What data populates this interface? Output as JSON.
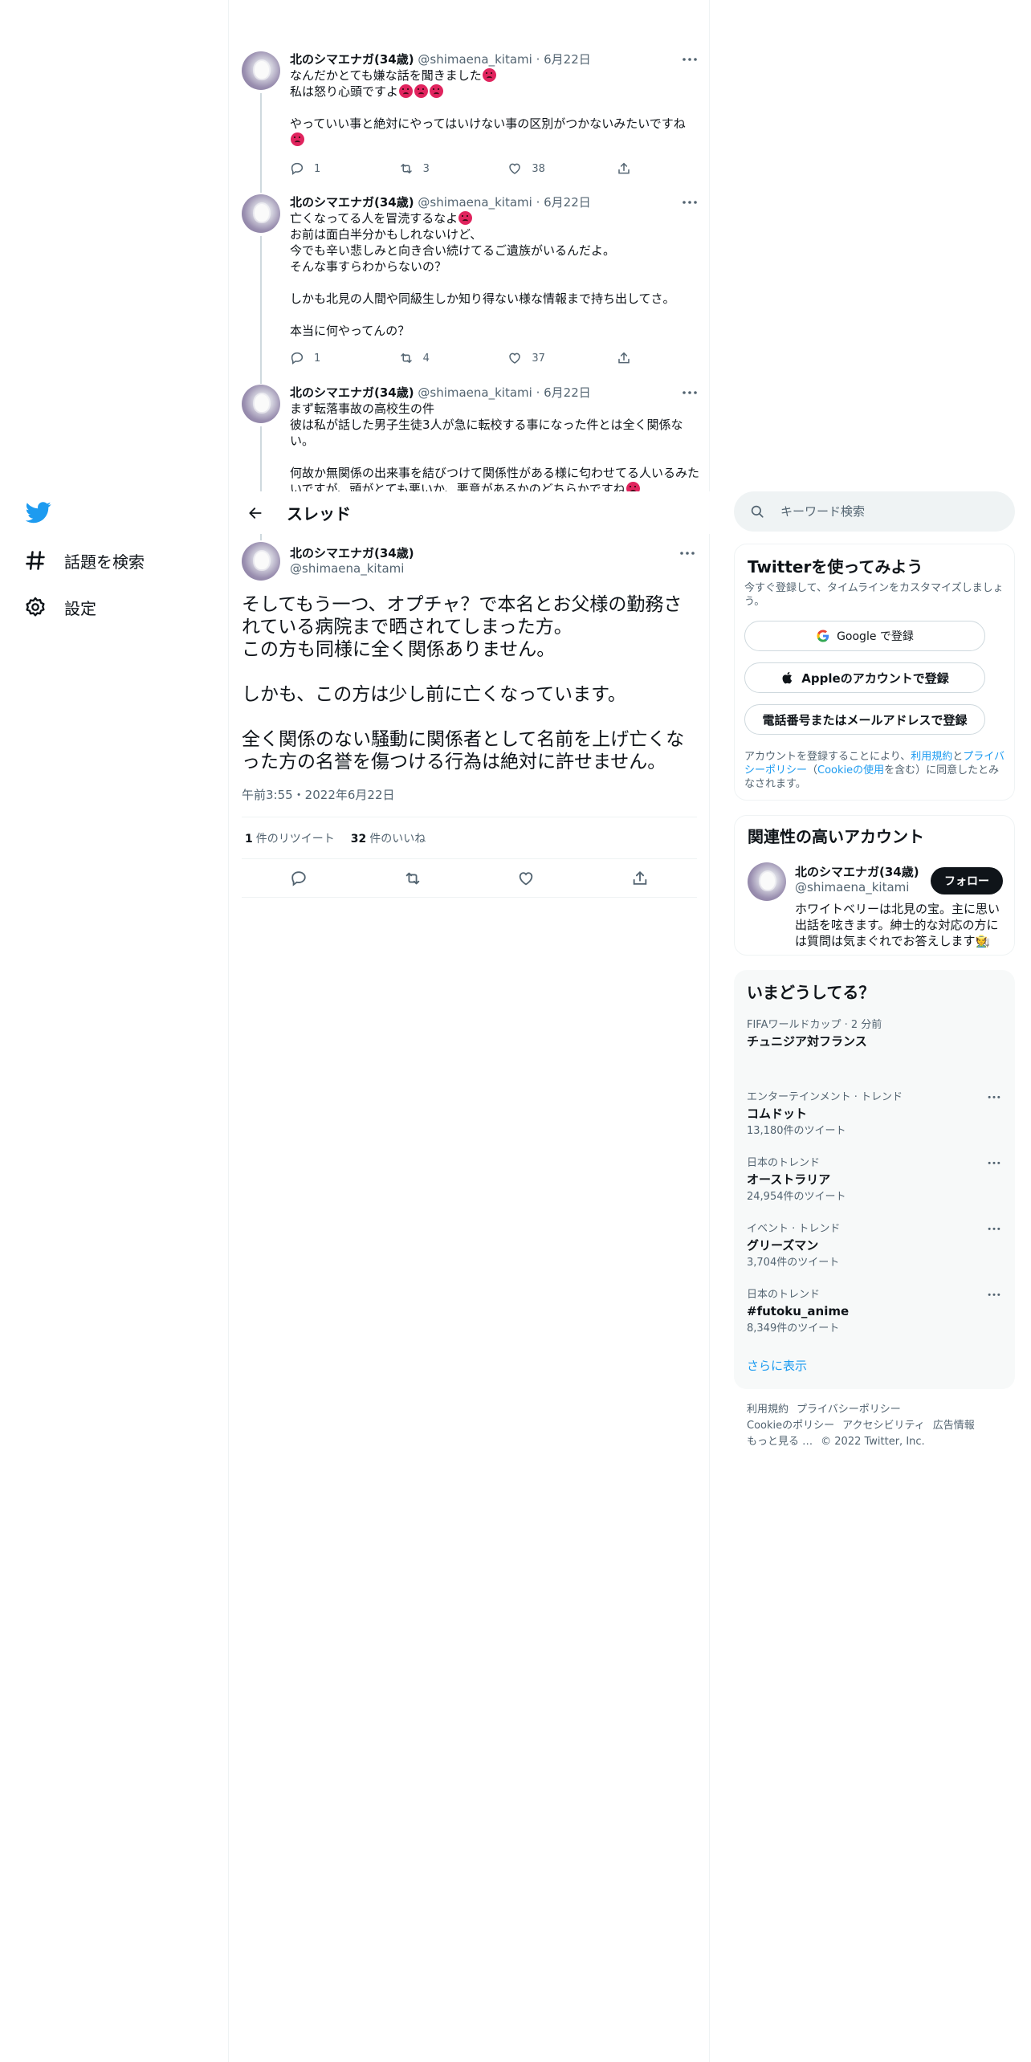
{
  "nav": {
    "explore_label": "話題を検索",
    "settings_label": "設定"
  },
  "tweets": [
    {
      "name": "北のシマエナガ(34歳)",
      "handle": "@shimaena_kitami",
      "date": "· 6月22日",
      "text_a": "なんだかとても嫌な話を聞きました",
      "text_b": "\n私は怒り心頭ですよ",
      "text_c": "\n\nやっていい事と絶対にやってはいけない事の区別がつかないみたいですね\n",
      "replies": "1",
      "retweets": "3",
      "likes": "38"
    },
    {
      "name": "北のシマエナガ(34歳)",
      "handle": "@shimaena_kitami",
      "date": "· 6月22日",
      "text_a": "亡くなってる人を冒涜するなよ",
      "text_c": "\nお前は面白半分かもしれないけど、\n今でも辛い悲しみと向き合い続けてるご遺族がいるんだよ。\nそんな事すらわからないの？\n\nしかも北見の人間や同級生しか知り得ない様な情報まで持ち出してさ。\n\n本当に何やってんの？",
      "replies": "1",
      "retweets": "4",
      "likes": "37"
    },
    {
      "name": "北のシマエナガ(34歳)",
      "handle": "@shimaena_kitami",
      "date": "· 6月22日",
      "text_c": "まず転落事故の高校生の件\n彼は私が話した男子生徒3人が急に転校する事になった件とは全く関係ない。\n\n何故か無関係の出来事を結びつけて関係性がある様に匂わせてる人いるみたいですが、頭がとても悪いか、悪意があるかのどちらかですね"
    }
  ],
  "header": {
    "title": "スレッド"
  },
  "focal": {
    "name": "北のシマエナガ(34歳)",
    "handle": "@shimaena_kitami",
    "text": "そしてもう一つ、オプチャ？で本名とお父様の勤務されている病院まで晒されてしまった方。\nこの方も同様に全く関係ありません。\n\nしかも、この方は少し前に亡くなっています。\n\n全く関係のない騒動に関係者として名前を上げ亡くなった方の名誉を傷つける行為は絶対に許せません。",
    "timestamp": "午前3:55・2022年6月22日",
    "retweets_count": "1",
    "retweets_label": "件のリツイート",
    "likes_count": "32",
    "likes_label": "件のいいね"
  },
  "search": {
    "placeholder": "キーワード検索"
  },
  "signup": {
    "title": "Twitterを使ってみよう",
    "subtitle": "今すぐ登録して、タイムラインをカスタマイズしましょう。",
    "google": "Google で登録",
    "apple": "Appleのアカウントで登録",
    "phone": "電話番号またはメールアドレスで登録",
    "legal_1": "アカウントを登録することにより、",
    "legal_terms": "利用規約",
    "legal_2": "と",
    "legal_privacy": "プライバシーポリシー",
    "legal_3": "（",
    "legal_cookie": "Cookieの使用",
    "legal_4": "を含む）に同意したとみなされます。"
  },
  "related": {
    "title": "関連性の高いアカウント",
    "name": "北のシマエナガ(34歳)",
    "handle": "@shimaena_kitami",
    "follow": "フォロー",
    "bio": "ホワイトベリーは北見の宝。主に思い出話を呟きます。紳士的な対応の方には質問は気まぐれでお答えします🧑‍🌾"
  },
  "trends": {
    "title": "いまどうしてる？",
    "items": [
      {
        "ctx": "FIFAワールドカップ · 2 分前",
        "title": "チュニジア対フランス",
        "count": ""
      },
      {
        "ctx": "エンターテインメント · トレンド",
        "title": "コムドット",
        "count": "13,180件のツイート"
      },
      {
        "ctx": "日本のトレンド",
        "title": "オーストラリア",
        "count": "24,954件のツイート"
      },
      {
        "ctx": "イベント · トレンド",
        "title": "グリーズマン",
        "count": "3,704件のツイート"
      },
      {
        "ctx": "日本のトレンド",
        "title": "#futoku_anime",
        "count": "8,349件のツイート"
      }
    ],
    "show_more": "さらに表示"
  },
  "footer": {
    "terms": "利用規約",
    "privacy": "プライバシーポリシー",
    "cookie": "Cookieのポリシー",
    "accessibility": "アクセシビリティ",
    "ads": "広告情報",
    "more": "もっと見る …",
    "copyright": "© 2022 Twitter, Inc."
  },
  "colors": {
    "accent": "#1d9bf0",
    "text": "#0f1419",
    "secondary": "#536471",
    "border": "#eff3f4"
  }
}
